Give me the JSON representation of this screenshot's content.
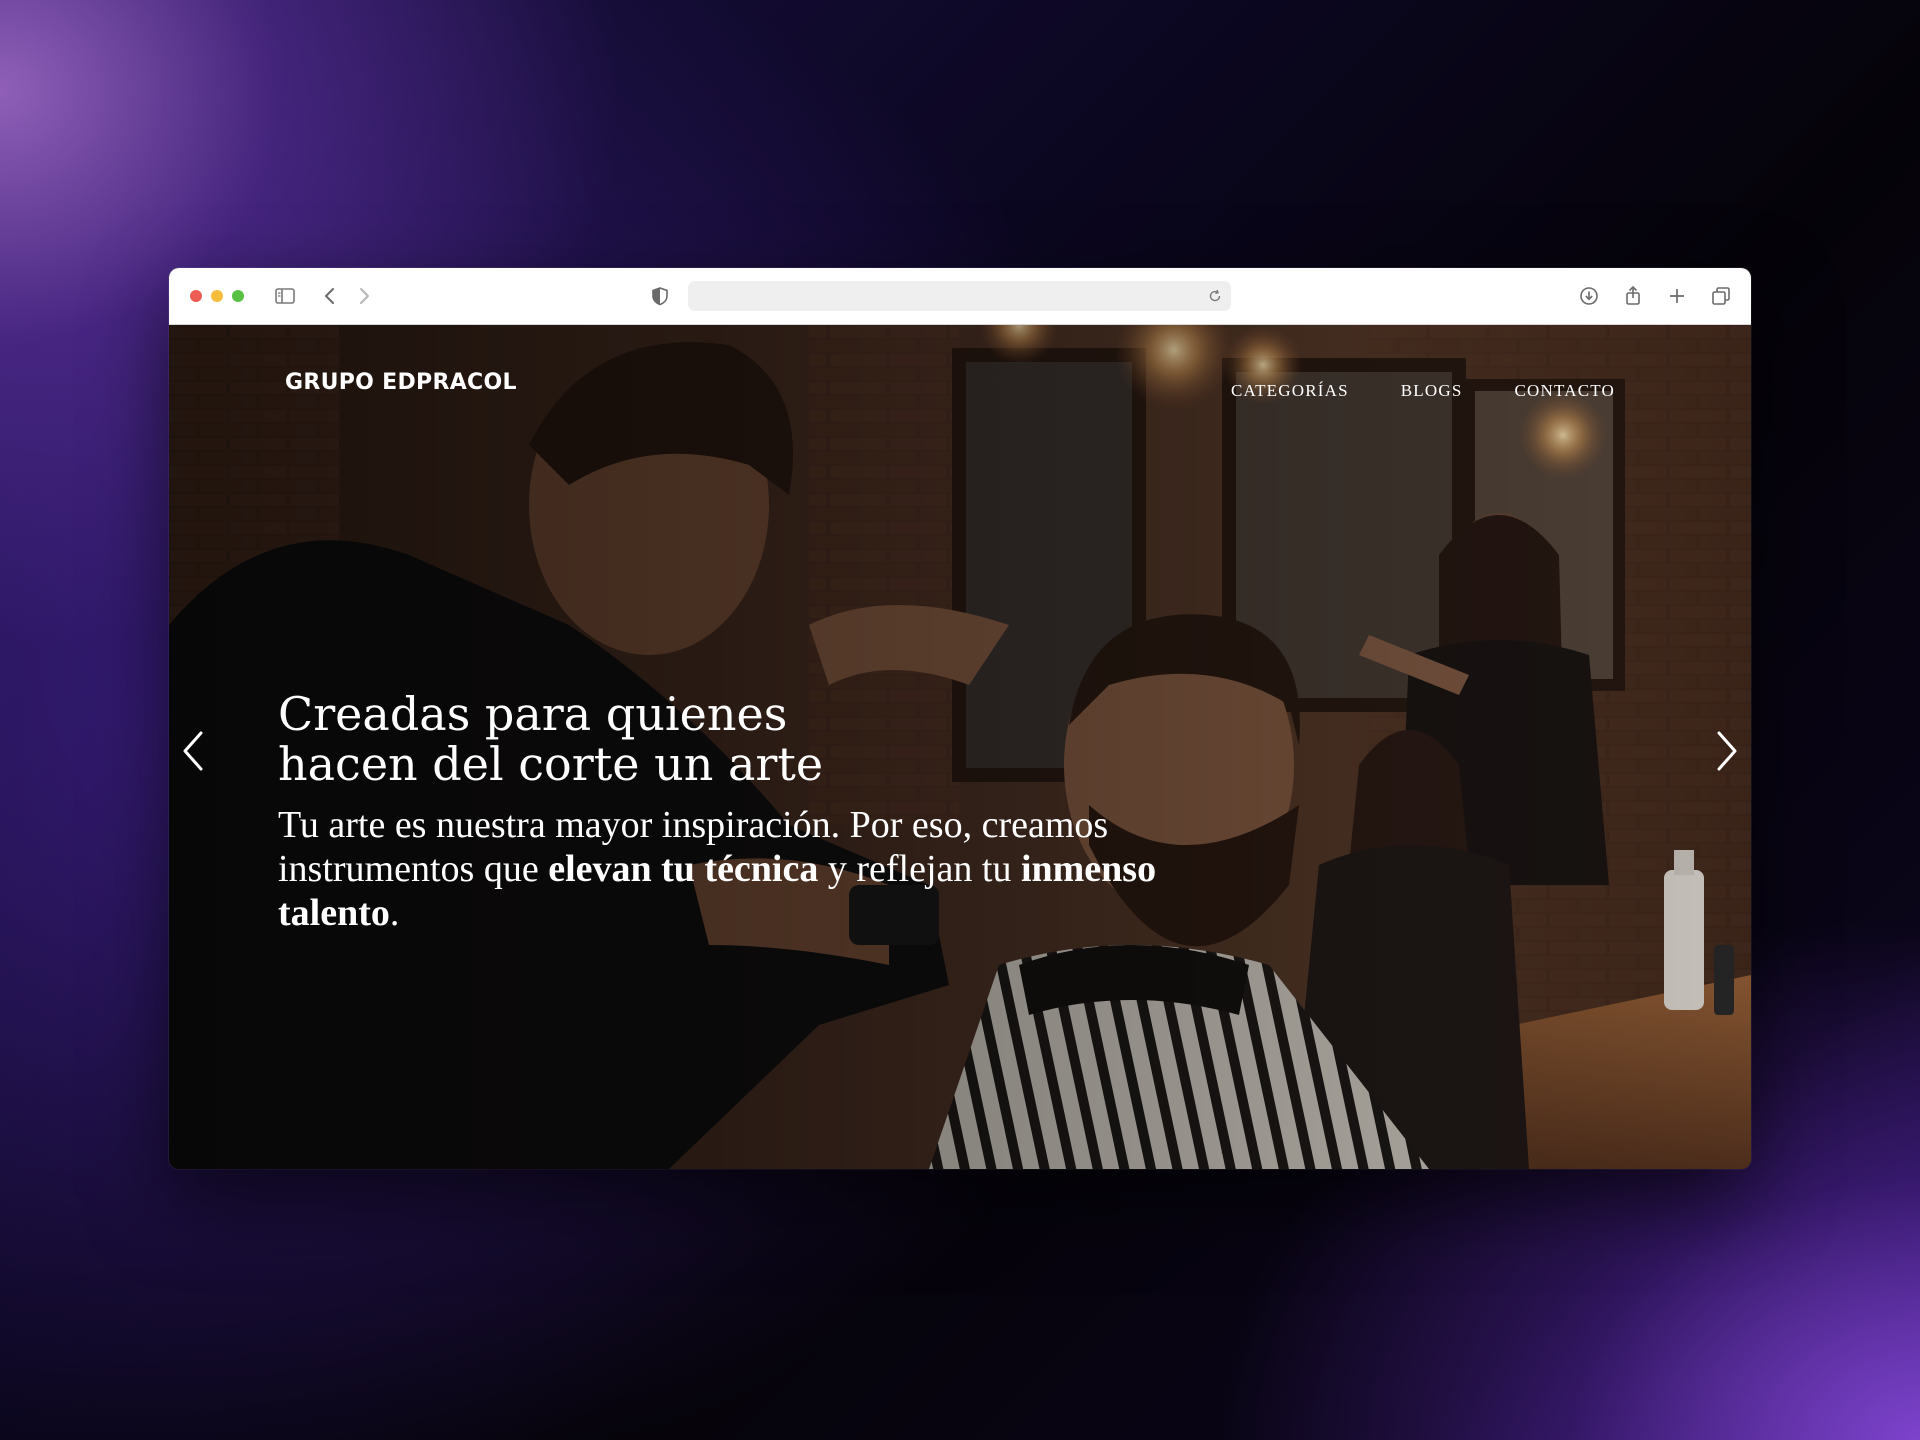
{
  "browser": {
    "address": ""
  },
  "site": {
    "logo": "GRUPO EDPRACOL",
    "nav": [
      "CATEGORÍAS",
      "BLOGS",
      "CONTACTO"
    ]
  },
  "hero": {
    "headline": "Creadas para quienes hacen del corte un arte",
    "sub_part1": "Tu arte es nuestra mayor inspiración. Por eso, creamos instrumentos que ",
    "sub_bold1": "elevan tu técnica",
    "sub_part2": " y reflejan tu ",
    "sub_bold2": "inmenso talento",
    "sub_part3": "."
  },
  "icons": {
    "prev": "chevron-left-icon",
    "next": "chevron-right-icon"
  },
  "colors": {
    "traffic_red": "#ee5d54",
    "traffic_yellow": "#f5bd3b",
    "traffic_green": "#58c143",
    "text": "#ffffff"
  }
}
